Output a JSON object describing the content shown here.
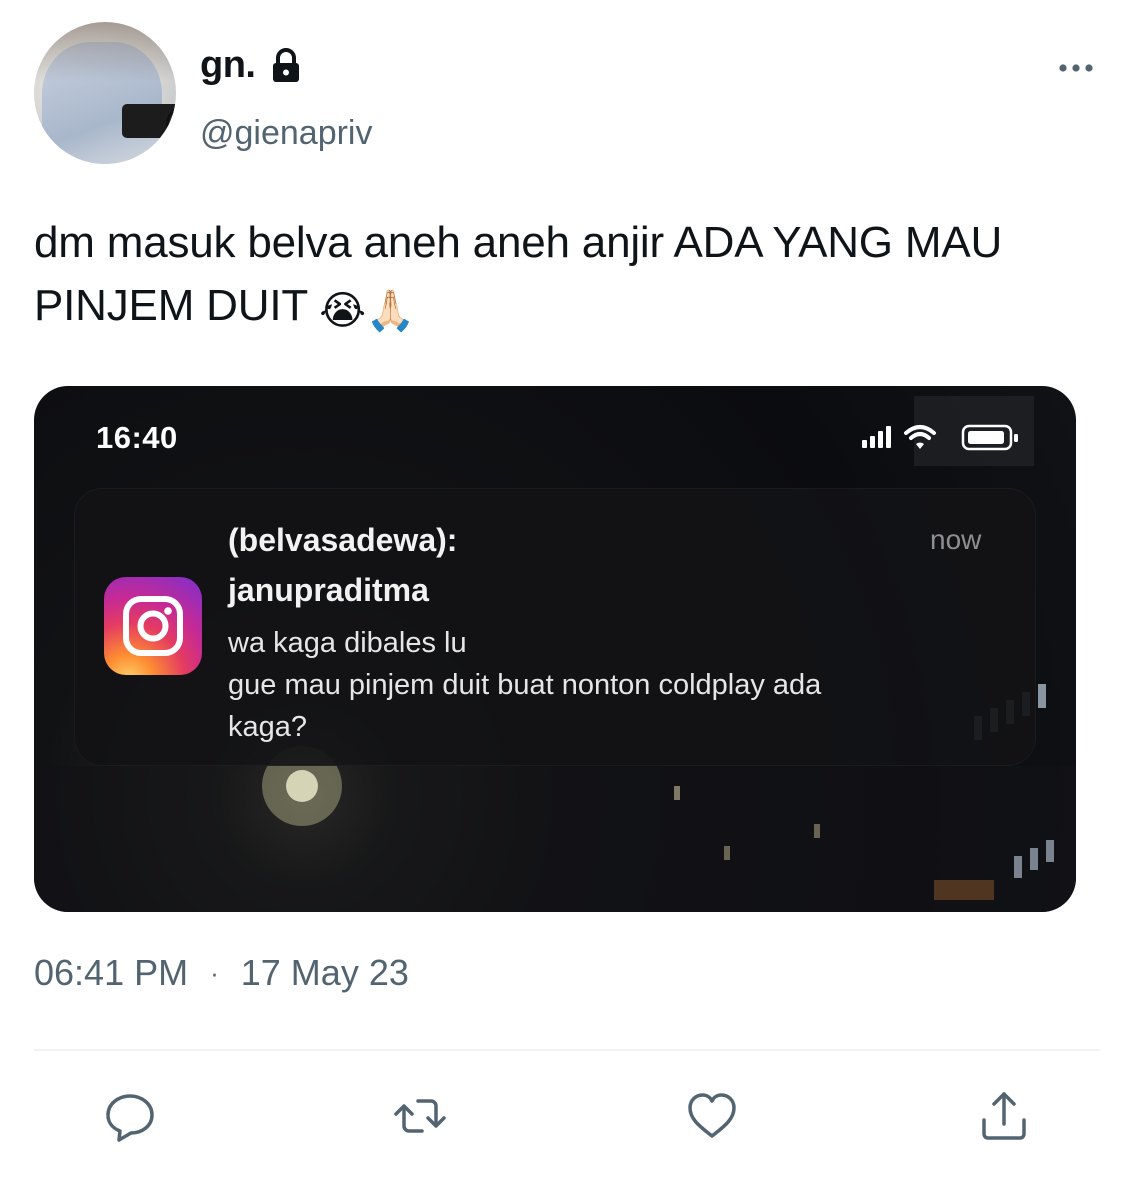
{
  "author": {
    "display_name": "gn.",
    "handle": "@gienapriv",
    "protected_icon": "lock-icon",
    "avatar": "profile-photo"
  },
  "tweet": {
    "text": "dm masuk belva aneh aneh anjir ADA YANG MAU PINJEM DUIT",
    "emojis": "😭🙏🏻"
  },
  "media": {
    "status_bar": {
      "time": "16:40",
      "icons": [
        "signal-icon",
        "wifi-icon",
        "battery-icon"
      ]
    },
    "notification": {
      "app_icon": "instagram-icon",
      "sender": "(belvasadewa):",
      "time": "now",
      "title": "janupraditma",
      "body_lines": [
        "wa kaga dibales lu",
        "gue mau pinjem duit buat nonton coldplay ada",
        "kaga?"
      ]
    }
  },
  "meta": {
    "time": "06:41 PM",
    "separator": "·",
    "date": "17 May 23"
  },
  "actions": {
    "icons": [
      "reply-icon",
      "retweet-icon",
      "like-icon",
      "share-icon"
    ]
  },
  "colors": {
    "text": "#0f1419",
    "secondary": "#536471",
    "divider": "#eff3f4"
  }
}
